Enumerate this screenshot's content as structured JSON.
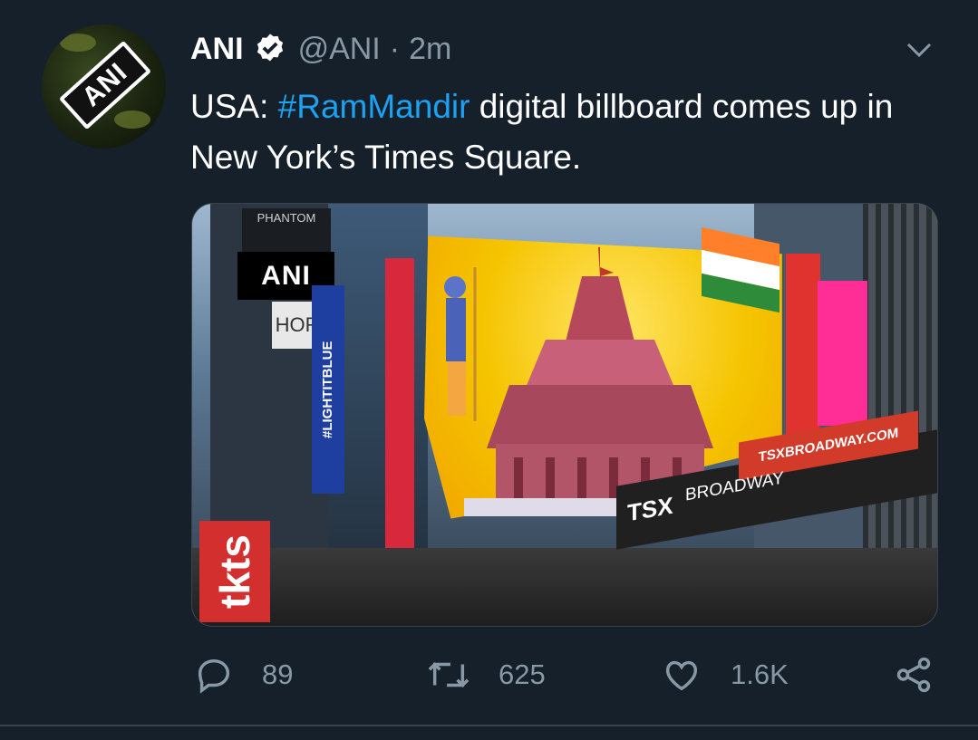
{
  "tweet": {
    "author_name": "ANI",
    "handle": "@ANI",
    "separator": "·",
    "time": "2m",
    "avatar_text": "ANI",
    "text_prefix": "USA: ",
    "hashtag": "#RamMandir",
    "text_suffix": " digital billboard comes up in New York’s Times Square."
  },
  "media": {
    "watermark": "ANI",
    "signs": {
      "lightit": "#LIGHTITBLUE",
      "tkts": "tkts",
      "tsx_url": "TSXBROADWAY.COM",
      "tsx_logo": "TSX",
      "broadway": "BROADWAY",
      "phantom": "PHANTOM",
      "horror": "HORR"
    }
  },
  "actions": {
    "replies": "89",
    "retweets": "625",
    "likes": "1.6K"
  },
  "colors": {
    "background": "#15202b",
    "hashtag": "#1da1f2",
    "muted": "#8899a6",
    "verified": "#ffffff"
  },
  "icons": [
    "verified-icon",
    "chevron-down-icon",
    "reply-icon",
    "retweet-icon",
    "like-icon",
    "share-icon"
  ]
}
